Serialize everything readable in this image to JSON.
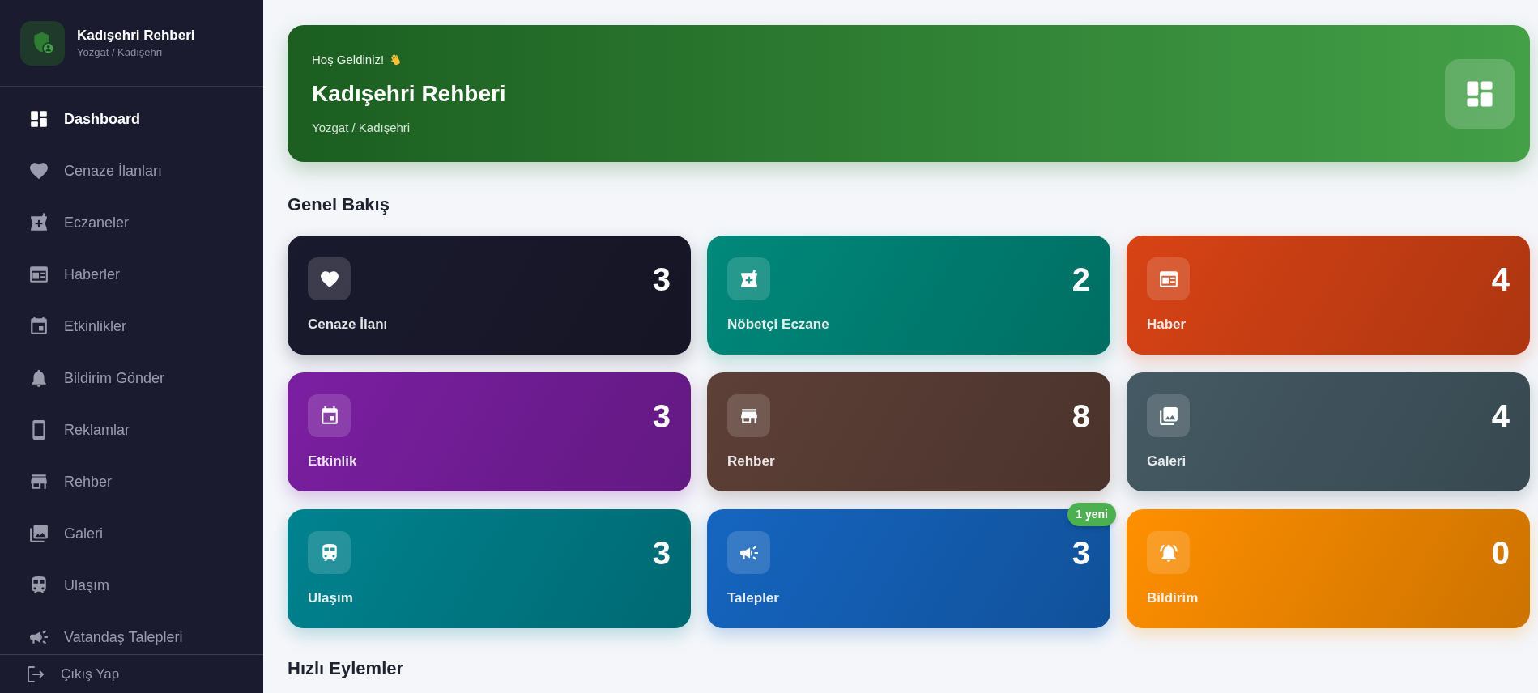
{
  "sidebar": {
    "title": "Kadışehri Rehberi",
    "subtitle": "Yozgat / Kadışehri",
    "items": [
      {
        "label": "Dashboard",
        "selected": true
      },
      {
        "label": "Cenaze İlanları",
        "selected": false
      },
      {
        "label": "Eczaneler",
        "selected": false
      },
      {
        "label": "Haberler",
        "selected": false
      },
      {
        "label": "Etkinlikler",
        "selected": false
      },
      {
        "label": "Bildirim Gönder",
        "selected": false
      },
      {
        "label": "Reklamlar",
        "selected": false
      },
      {
        "label": "Rehber",
        "selected": false
      },
      {
        "label": "Galeri",
        "selected": false
      },
      {
        "label": "Ulaşım",
        "selected": false
      },
      {
        "label": "Vatandaş Talepleri",
        "selected": false
      }
    ],
    "footer_item": {
      "label": "Çıkış Yap"
    }
  },
  "banner": {
    "greeting": "Hoş Geldiniz!",
    "title": "Kadışehri Rehberi",
    "subtitle": "Yozgat / Kadışehri"
  },
  "overview": {
    "heading": "Genel Bakış",
    "cards": [
      {
        "label": "Cenaze İlanı",
        "count": "3",
        "color": "#1a1a2e"
      },
      {
        "label": "Nöbetçi Eczane",
        "count": "2",
        "color": "#00897b"
      },
      {
        "label": "Haber",
        "count": "4",
        "color": "#d84315"
      },
      {
        "label": "Etkinlik",
        "count": "3",
        "color": "#7b1fa2"
      },
      {
        "label": "Rehber",
        "count": "8",
        "color": "#5d4037"
      },
      {
        "label": "Galeri",
        "count": "4",
        "color": "#455a64"
      },
      {
        "label": "Ulaşım",
        "count": "3",
        "color": "#00838f"
      },
      {
        "label": "Talepler",
        "count": "3",
        "color": "#1565c0"
      },
      {
        "label": "Bildirim",
        "count": "0",
        "color": "#ff8f00"
      }
    ],
    "new_items_badge": "1 yeni"
  },
  "quick_actions": {
    "heading": "Hızlı Eylemler"
  }
}
